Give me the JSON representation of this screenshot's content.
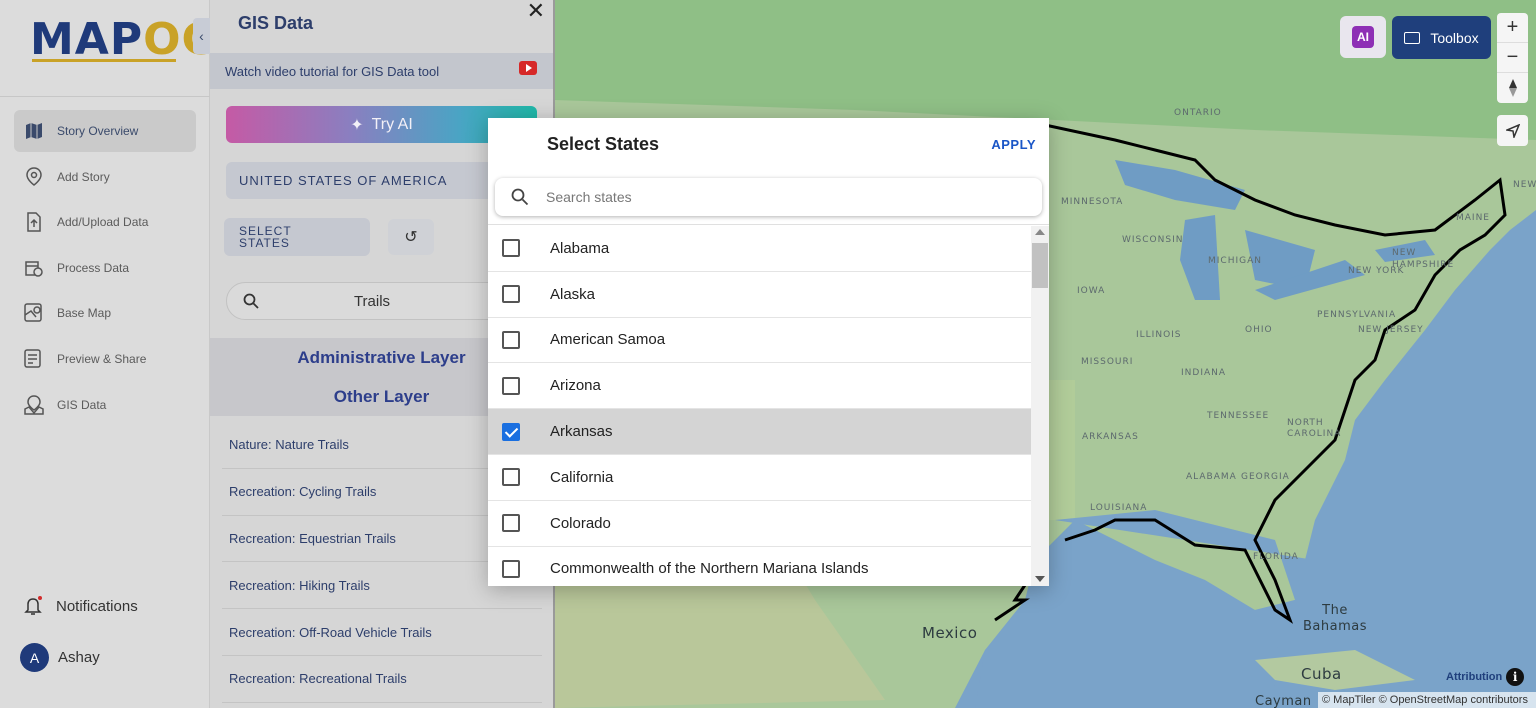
{
  "app": {
    "logo": {
      "part1": "MAP",
      "part2": "OG"
    }
  },
  "sidebar": {
    "items": [
      {
        "label": "Story Overview",
        "icon": "map-icon",
        "active": true
      },
      {
        "label": "Add Story",
        "icon": "location-pin-icon"
      },
      {
        "label": "Add/Upload Data",
        "icon": "upload-file-icon"
      },
      {
        "label": "Process Data",
        "icon": "process-data-icon"
      },
      {
        "label": "Base Map",
        "icon": "base-map-icon"
      },
      {
        "label": "Preview & Share",
        "icon": "preview-share-icon"
      },
      {
        "label": "GIS Data",
        "icon": "gis-data-icon"
      }
    ],
    "notifications_label": "Notifications",
    "user": {
      "initial": "A",
      "name": "Ashay"
    }
  },
  "panel": {
    "title": "GIS Data",
    "close": "✕",
    "tutorial_text": "Watch video tutorial for GIS Data tool",
    "try_ai": "Try AI",
    "country": "UNITED STATES OF AMERICA",
    "select_states_line1": "SELECT",
    "select_states_line2": "STATES",
    "search_value": "Trails",
    "admin_layer": "Administrative Layer",
    "other_layer": "Other Layer",
    "trails": [
      "Nature: Nature Trails",
      "Recreation: Cycling Trails",
      "Recreation: Equestrian Trails",
      "Recreation: Hiking Trails",
      "Recreation: Off-Road Vehicle Trails",
      "Recreation: Recreational Trails"
    ]
  },
  "map": {
    "labels": {
      "ontario": "ONTARIO",
      "minnesota": "MINNESOTA",
      "wisconsin": "WISCONSIN",
      "michigan": "MICHIGAN",
      "iowa": "IOWA",
      "illinois": "ILLINOIS",
      "ohio": "OHIO",
      "indiana": "INDIANA",
      "missouri": "MISSOURI",
      "pennsylvania": "PENNSYLVANIA",
      "new_york": "NEW YORK",
      "new_jersey": "NEW JERSEY",
      "maine": "MAINE",
      "new_hampshire": "NEW HAMPSHIRE",
      "tennessee": "TENNESSEE",
      "north_carolina": "NORTH CAROLINA",
      "arkansas": "ARKANSAS",
      "alabama": "ALABAMA",
      "georgia": "GEORGIA",
      "louisiana": "LOUISIANA",
      "florida": "FLORIDA",
      "mexico": "Mexico",
      "bahamas": "The Bahamas",
      "cuba": "Cuba",
      "cayman": "Cayman",
      "new_short": "NEW"
    },
    "toolbox_label": "Toolbox",
    "ai_label": "AI",
    "zoom_in": "+",
    "zoom_out": "−",
    "attribution": "Attribution",
    "credits": "© MapTiler © OpenStreetMap contributors"
  },
  "modal": {
    "title": "Select States",
    "apply": "APPLY",
    "search_placeholder": "Search states",
    "states": [
      {
        "name": "Alabama",
        "checked": false
      },
      {
        "name": "Alaska",
        "checked": false
      },
      {
        "name": "American Samoa",
        "checked": false
      },
      {
        "name": "Arizona",
        "checked": false
      },
      {
        "name": "Arkansas",
        "checked": true
      },
      {
        "name": "California",
        "checked": false
      },
      {
        "name": "Colorado",
        "checked": false
      },
      {
        "name": "Commonwealth of the Northern Mariana Islands",
        "checked": false
      }
    ]
  },
  "colors": {
    "brand": "#1f3a7a",
    "accent_gold": "#c9a227",
    "apply_blue": "#1a56c7",
    "checkbox_blue": "#1a6fe0"
  }
}
